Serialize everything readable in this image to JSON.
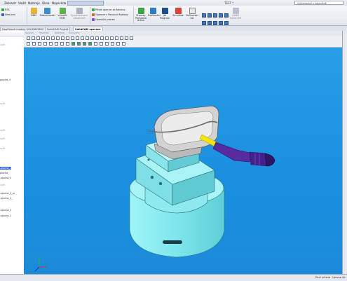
{
  "app": {
    "title": "TEST *",
    "search_placeholder": "Vyhledávání v nápovědě"
  },
  "menu": [
    "Zobrazit",
    "Vložit",
    "Nástroje",
    "Okna",
    "Nápověda"
  ],
  "ribbon": {
    "left_items": [
      "RSS",
      "View.xml"
    ],
    "buttons": [
      "DDD",
      "Dokončovací",
      "Vytvořit EDM",
      "Synchronizace zásobníků"
    ],
    "small_list": [
      "Přidat operaci ze šablony",
      "Operace s Posunutí šablony",
      "Operační proces"
    ],
    "buttons2": [
      "Procesy Pořadová dráha",
      "Profilování",
      "Jet Program",
      "Simulace",
      "Seřizovací list",
      "Uložit SolidCAM"
    ]
  },
  "tabs": [
    "Doplňkové moduly SOLIDWORKS",
    "SolidCAM Projekt",
    "SolidCAM operace"
  ],
  "view_tabs": [
    "Soubor",
    "Modrost",
    "Nástroje",
    "Simulace"
  ],
  "tree": [
    {
      "label": "zpět",
      "style": "dim"
    },
    {
      "label": "plocha_4",
      "style": "normal"
    },
    {
      "label": "zpět",
      "style": "dim"
    },
    {
      "label": "zpět",
      "style": "dim"
    },
    {
      "label": "zpět",
      "style": "dim"
    },
    {
      "label": "zpět",
      "style": "dim"
    },
    {
      "label": "-plocha_1",
      "style": "sel"
    },
    {
      "label": "plocha_",
      "style": "normal"
    },
    {
      "label": "-plocha_2",
      "style": "normal"
    },
    {
      "label": "zpět",
      "style": "dim"
    },
    {
      "label": "-plocha_2_m",
      "style": "normal"
    },
    {
      "label": "-plocha_2_",
      "style": "normal"
    },
    {
      "label": "-plocha_3",
      "style": "normal"
    },
    {
      "label": "-plocha_1",
      "style": "normal"
    }
  ],
  "status": {
    "left": "Plně určená",
    "right": "Úprava Se"
  },
  "colors": {
    "viewport": "#1b8fe0",
    "part": "#7ef0f0",
    "tool": "#5a2aa0",
    "tool_tip": "#f2e800",
    "fixture": "#a8eef2"
  }
}
